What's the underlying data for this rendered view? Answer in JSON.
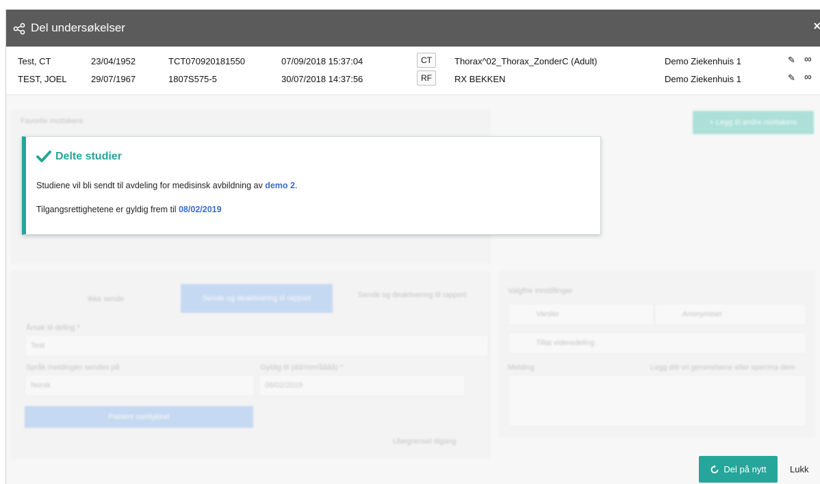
{
  "window": {
    "title": "Del undersøkelser",
    "close_symbol": "×"
  },
  "studies": [
    {
      "name": "Test, CT",
      "dob": "23/04/1952",
      "accession": "TCT070920181550",
      "datetime": "07/09/2018 15:37:04",
      "modality": "CT",
      "description": "Thorax^02_Thorax_ZonderC (Adult)",
      "institution": "Demo Ziekenhuis 1"
    },
    {
      "name": "TEST, JOEL",
      "dob": "29/07/1967",
      "accession": "1807S575-5",
      "datetime": "30/07/2018 14:37:56",
      "modality": "RF",
      "description": "RX BEKKEN",
      "institution": "Demo Ziekenhuis 1"
    }
  ],
  "icons": {
    "edit": "✎",
    "link": "∞",
    "share": "share-icon",
    "check": "check-icon",
    "refresh": "refresh-icon"
  },
  "alert": {
    "title": "Delte studier",
    "line1_prefix": "Studiene vil bli sendt til avdeling for medisinsk avbildning av ",
    "line1_link": "demo 2",
    "line1_suffix": ".",
    "line2_prefix": "Tilgangsrettighetene er gyldig frem til ",
    "line2_date": "08/02/2019"
  },
  "background_form": {
    "favorites_label": "Favorite mottakere",
    "add_favorites": "+ Legg til andre mottakere",
    "tab_new": "Ikke sende",
    "tab_send": "Sende og deaktivering til rapport",
    "tab_send2": "Sende og deaktivering til rapport",
    "reason_label": "Årsak til deling *",
    "reason_value": "Test",
    "language_label": "Språk meldingen sendes på",
    "language_value": "Norsk",
    "valid_label": "Gyldig til (dd/mm/åååå) *",
    "valid_value": "08/02/2019",
    "patient_button": "Pasient samtykket",
    "unlimited": "Ubegrenset tilgang",
    "options_label": "Valgfrie innstillinger",
    "opt1": "Varsler",
    "opt2": "Anonymiser",
    "opt3": "Tillat videredeling",
    "message_label": "Melding",
    "message_hint": "Legg ditt vri generelsene eller sperrina dem"
  },
  "footer": {
    "reshare_label": "Del på nytt",
    "close_label": "Lukk"
  },
  "colors": {
    "titlebar": "#5b5b5b",
    "accent": "#26a69a",
    "link": "#3b6dc7"
  }
}
